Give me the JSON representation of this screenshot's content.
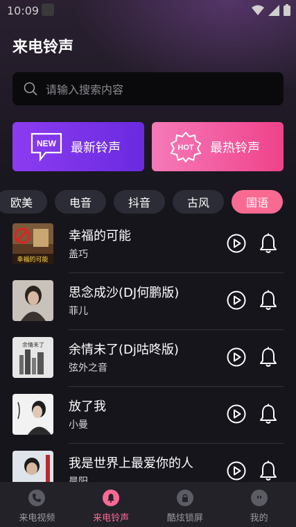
{
  "status_bar": {
    "time": "10:09"
  },
  "page_title": "来电铃声",
  "search": {
    "placeholder": "请输入搜索内容"
  },
  "banners": {
    "new": {
      "badge": "NEW",
      "label": "最新铃声",
      "color": "#7b34ea"
    },
    "hot": {
      "badge": "HOT",
      "label": "最热铃声",
      "color": "#f45a9c"
    }
  },
  "categories": [
    {
      "label": "欧美",
      "active": false
    },
    {
      "label": "电音",
      "active": false
    },
    {
      "label": "抖音",
      "active": false
    },
    {
      "label": "古风",
      "active": false
    },
    {
      "label": "国语",
      "active": true
    }
  ],
  "songs": [
    {
      "title": "幸福的可能",
      "artist": "盖巧",
      "cover_text": "幸福的可能"
    },
    {
      "title": "思念成沙(DJ何鹏版)",
      "artist": "菲儿",
      "cover_text": ""
    },
    {
      "title": "余情未了(Dj咕咚版)",
      "artist": "弦外之音",
      "cover_text": "余情未了"
    },
    {
      "title": "放了我",
      "artist": "小曼",
      "cover_text": ""
    },
    {
      "title": "我是世界上最爱你的人",
      "artist": "晨阳",
      "cover_text": ""
    }
  ],
  "bottom_nav": [
    {
      "label": "来电视频",
      "icon": "phone-icon",
      "active": false
    },
    {
      "label": "来电铃声",
      "icon": "bell-icon",
      "active": true
    },
    {
      "label": "酷炫锁屏",
      "icon": "lock-icon",
      "active": false
    },
    {
      "label": "我的",
      "icon": "face-icon",
      "active": false
    }
  ],
  "accent_color": "#f96a93"
}
